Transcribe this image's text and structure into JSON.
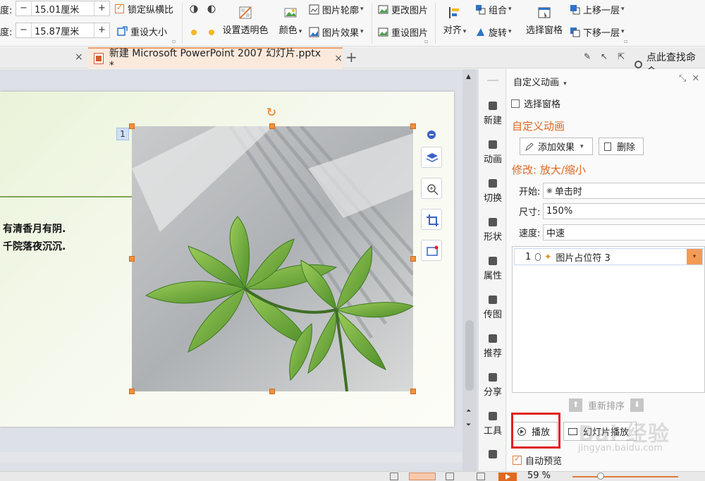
{
  "ribbon": {
    "width_label": "度:",
    "width_value": "15.01厘米",
    "height_label": "度:",
    "height_value": "15.87厘米",
    "spin_minus": "−",
    "spin_plus": "+",
    "lock_ratio": "锁定纵横比",
    "reset_size": "重设大小",
    "set_transparent": "设置透明色",
    "color": "颜色",
    "pic_outline": "图片轮廓",
    "pic_effect": "图片效果",
    "change_pic": "更改图片",
    "reset_pic": "重设图片",
    "align": "对齐",
    "group": "组合",
    "rotate": "旋转",
    "selection_pane": "选择窗格",
    "bring_forward": "上移一层",
    "send_backward": "下移一层"
  },
  "tabs": {
    "doc_title": "新建 Microsoft PowerPoint 2007 幻灯片.pptx *",
    "close_glyph": "×",
    "new_tab_glyph": "+",
    "search_cmd": "点此查找命令"
  },
  "slide": {
    "poem_line1": "有清香月有阴.",
    "poem_line2": "千院落夜沉沉.",
    "anim_tag": "1"
  },
  "sidestrip": {
    "items": [
      "新建",
      "动画",
      "切换",
      "形状",
      "属性",
      "传图",
      "推荐",
      "分享",
      "工具"
    ]
  },
  "pane": {
    "header": "自定义动画",
    "select_pane": "选择窗格",
    "section_title": "自定义动画",
    "add_effect": "添加效果",
    "delete": "删除",
    "modify_title": "修改: 放大/缩小",
    "start_label": "开始:",
    "start_value": "单击时",
    "size_label": "尺寸:",
    "size_value": "150%",
    "speed_label": "速度:",
    "speed_value": "中速",
    "effect_index": "1",
    "effect_name": "图片占位符 3",
    "reorder": "重新排序",
    "play": "播放",
    "slideshow": "幻灯片播放",
    "autopreview": "自动预览"
  },
  "statusbar": {
    "zoom": "59 %",
    "zoom_percent": 59
  },
  "watermark": {
    "brand": "Bai 经验",
    "url": "jingyan.baidu.com"
  },
  "colors": {
    "accent": "#e0661f",
    "handle": "#f0913e",
    "highlight_box": "#e02020"
  }
}
